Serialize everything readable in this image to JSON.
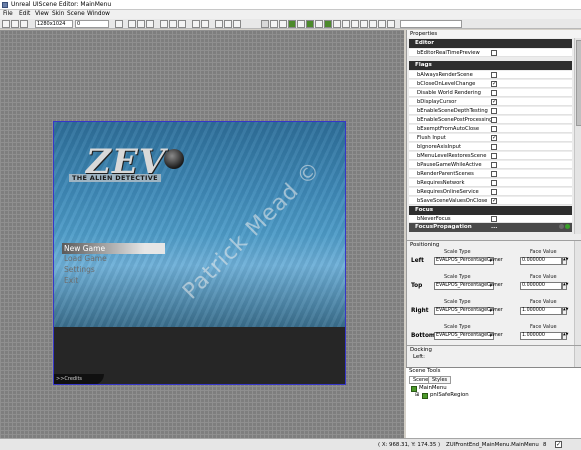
{
  "window": {
    "title": "Unreal UIScene Editor: MainMenu"
  },
  "menubar": [
    "File",
    "Edit",
    "View",
    "Skin",
    "Scene",
    "Window"
  ],
  "toolbar": {
    "resolution": "1280x1024",
    "value": "0"
  },
  "scene": {
    "logo_title": "ZEV",
    "logo_subtitle": "THE ALIEN DETECTIVE",
    "menu_items": [
      "New Game",
      "Load Game",
      "Settings",
      "Exit"
    ],
    "credits": ">>Credits"
  },
  "watermark": "Patrick Mead ©",
  "properties": {
    "title": "Properties",
    "editor_header": "Editor",
    "editor_props": [
      {
        "label": "bEditorRealTimePreview",
        "checked": false
      }
    ],
    "flags_header": "Flags",
    "flags_props": [
      {
        "label": "bAlwaysRenderScene",
        "checked": false
      },
      {
        "label": "bCloseOnLevelChange",
        "checked": true
      },
      {
        "label": "Disable World Rendering",
        "checked": false
      },
      {
        "label": "bDisplayCursor",
        "checked": true
      },
      {
        "label": "bEnableSceneDepthTesting",
        "checked": false
      },
      {
        "label": "bEnableScenePostProcessing",
        "checked": false
      },
      {
        "label": "bExemptFromAutoClose",
        "checked": false
      },
      {
        "label": "Flush Input",
        "checked": true
      },
      {
        "label": "bIgnoreAxisInput",
        "checked": false
      },
      {
        "label": "bMenuLevelRestoresScene",
        "checked": false
      },
      {
        "label": "bPauseGameWhileActive",
        "checked": false
      },
      {
        "label": "bRenderParentScenes",
        "checked": false
      },
      {
        "label": "bRequiresNetwork",
        "checked": false
      },
      {
        "label": "bRequiresOnlineService",
        "checked": false
      },
      {
        "label": "bSaveSceneValuesOnClose",
        "checked": true
      }
    ],
    "focus_header": "Focus",
    "focus_props": [
      {
        "label": "bNeverFocus",
        "checked": false
      }
    ],
    "focus_propagation": "FocusPropagation",
    "focus_propagation_value": "..."
  },
  "positioning": {
    "title": "Positioning",
    "scale_type_label": "Scale Type",
    "face_value_label": "Face Value",
    "rows": [
      {
        "label": "Left",
        "scale_type": "EVALPOS_PercentageOwner",
        "value": "0.000000"
      },
      {
        "label": "Top",
        "scale_type": "EVALPOS_PercentageOwner",
        "value": "0.000000"
      },
      {
        "label": "Right",
        "scale_type": "EVALPOS_PercentageOwner",
        "value": "1.000000"
      },
      {
        "label": "Bottom",
        "scale_type": "EVALPOS_PercentageOwner",
        "value": "1.000000"
      }
    ]
  },
  "docking": {
    "title": "Docking",
    "left_label": "Left:"
  },
  "scene_tools": {
    "title": "Scene Tools",
    "tabs": [
      "Scene",
      "Styles"
    ],
    "tree": [
      "MainMenu",
      "pnlSafeRegion"
    ]
  },
  "status": {
    "coords": "( X: 968.31, Y: 174.35 )",
    "scene_name": "ZUIFrontEnd_MainMenu.MainMenu",
    "zoom": "8"
  }
}
